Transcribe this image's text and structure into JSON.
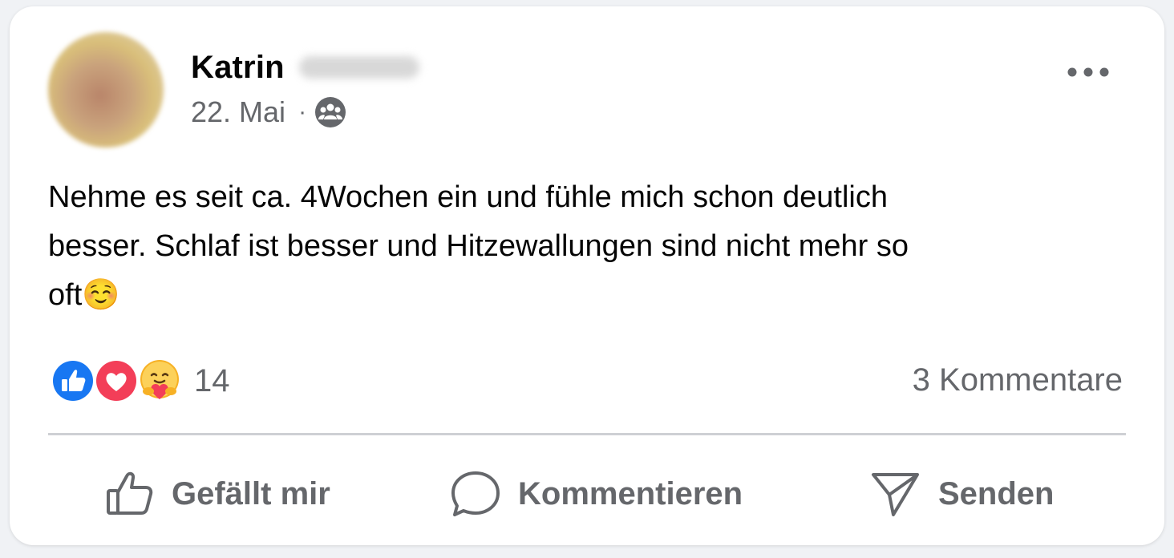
{
  "post": {
    "author_first_name": "Katrin",
    "date": "22. Mai",
    "separator": "·",
    "audience_icon": "friends-icon",
    "text": "Nehme es seit ca. 4Wochen ein und fühle mich schon deutlich\nbesser. Schlaf ist besser und Hitzewallungen sind nicht mehr so\noft☺️",
    "reactions": {
      "types": [
        "like",
        "love",
        "care"
      ],
      "count": "14"
    },
    "comments_label": "3 Kommentare"
  },
  "actions": {
    "like_label": "Gefällt mir",
    "comment_label": "Kommentieren",
    "send_label": "Senden"
  },
  "colors": {
    "like_blue": "#1877f2",
    "love_red": "#f33e58",
    "secondary_text": "#65676b",
    "primary_text": "#050505"
  }
}
